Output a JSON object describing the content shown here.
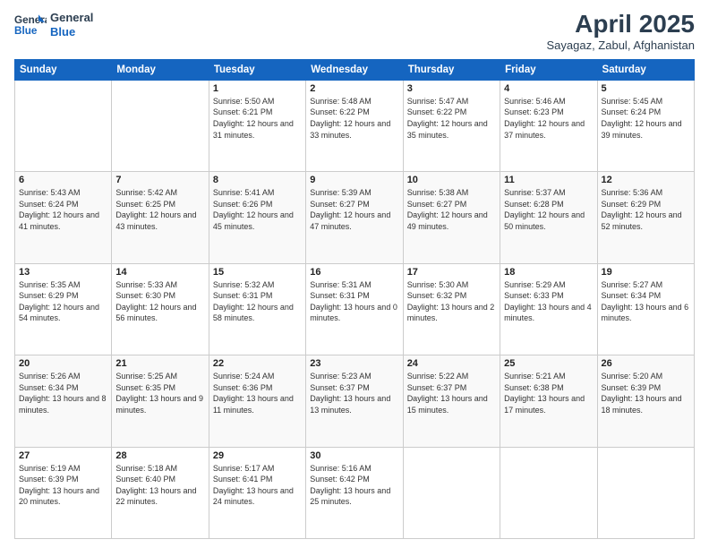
{
  "logo": {
    "line1": "General",
    "line2": "Blue"
  },
  "title": "April 2025",
  "subtitle": "Sayagaz, Zabul, Afghanistan",
  "weekdays": [
    "Sunday",
    "Monday",
    "Tuesday",
    "Wednesday",
    "Thursday",
    "Friday",
    "Saturday"
  ],
  "weeks": [
    [
      {
        "day": "",
        "info": ""
      },
      {
        "day": "",
        "info": ""
      },
      {
        "day": "1",
        "info": "Sunrise: 5:50 AM\nSunset: 6:21 PM\nDaylight: 12 hours\nand 31 minutes."
      },
      {
        "day": "2",
        "info": "Sunrise: 5:48 AM\nSunset: 6:22 PM\nDaylight: 12 hours\nand 33 minutes."
      },
      {
        "day": "3",
        "info": "Sunrise: 5:47 AM\nSunset: 6:22 PM\nDaylight: 12 hours\nand 35 minutes."
      },
      {
        "day": "4",
        "info": "Sunrise: 5:46 AM\nSunset: 6:23 PM\nDaylight: 12 hours\nand 37 minutes."
      },
      {
        "day": "5",
        "info": "Sunrise: 5:45 AM\nSunset: 6:24 PM\nDaylight: 12 hours\nand 39 minutes."
      }
    ],
    [
      {
        "day": "6",
        "info": "Sunrise: 5:43 AM\nSunset: 6:24 PM\nDaylight: 12 hours\nand 41 minutes."
      },
      {
        "day": "7",
        "info": "Sunrise: 5:42 AM\nSunset: 6:25 PM\nDaylight: 12 hours\nand 43 minutes."
      },
      {
        "day": "8",
        "info": "Sunrise: 5:41 AM\nSunset: 6:26 PM\nDaylight: 12 hours\nand 45 minutes."
      },
      {
        "day": "9",
        "info": "Sunrise: 5:39 AM\nSunset: 6:27 PM\nDaylight: 12 hours\nand 47 minutes."
      },
      {
        "day": "10",
        "info": "Sunrise: 5:38 AM\nSunset: 6:27 PM\nDaylight: 12 hours\nand 49 minutes."
      },
      {
        "day": "11",
        "info": "Sunrise: 5:37 AM\nSunset: 6:28 PM\nDaylight: 12 hours\nand 50 minutes."
      },
      {
        "day": "12",
        "info": "Sunrise: 5:36 AM\nSunset: 6:29 PM\nDaylight: 12 hours\nand 52 minutes."
      }
    ],
    [
      {
        "day": "13",
        "info": "Sunrise: 5:35 AM\nSunset: 6:29 PM\nDaylight: 12 hours\nand 54 minutes."
      },
      {
        "day": "14",
        "info": "Sunrise: 5:33 AM\nSunset: 6:30 PM\nDaylight: 12 hours\nand 56 minutes."
      },
      {
        "day": "15",
        "info": "Sunrise: 5:32 AM\nSunset: 6:31 PM\nDaylight: 12 hours\nand 58 minutes."
      },
      {
        "day": "16",
        "info": "Sunrise: 5:31 AM\nSunset: 6:31 PM\nDaylight: 13 hours\nand 0 minutes."
      },
      {
        "day": "17",
        "info": "Sunrise: 5:30 AM\nSunset: 6:32 PM\nDaylight: 13 hours\nand 2 minutes."
      },
      {
        "day": "18",
        "info": "Sunrise: 5:29 AM\nSunset: 6:33 PM\nDaylight: 13 hours\nand 4 minutes."
      },
      {
        "day": "19",
        "info": "Sunrise: 5:27 AM\nSunset: 6:34 PM\nDaylight: 13 hours\nand 6 minutes."
      }
    ],
    [
      {
        "day": "20",
        "info": "Sunrise: 5:26 AM\nSunset: 6:34 PM\nDaylight: 13 hours\nand 8 minutes."
      },
      {
        "day": "21",
        "info": "Sunrise: 5:25 AM\nSunset: 6:35 PM\nDaylight: 13 hours\nand 9 minutes."
      },
      {
        "day": "22",
        "info": "Sunrise: 5:24 AM\nSunset: 6:36 PM\nDaylight: 13 hours\nand 11 minutes."
      },
      {
        "day": "23",
        "info": "Sunrise: 5:23 AM\nSunset: 6:37 PM\nDaylight: 13 hours\nand 13 minutes."
      },
      {
        "day": "24",
        "info": "Sunrise: 5:22 AM\nSunset: 6:37 PM\nDaylight: 13 hours\nand 15 minutes."
      },
      {
        "day": "25",
        "info": "Sunrise: 5:21 AM\nSunset: 6:38 PM\nDaylight: 13 hours\nand 17 minutes."
      },
      {
        "day": "26",
        "info": "Sunrise: 5:20 AM\nSunset: 6:39 PM\nDaylight: 13 hours\nand 18 minutes."
      }
    ],
    [
      {
        "day": "27",
        "info": "Sunrise: 5:19 AM\nSunset: 6:39 PM\nDaylight: 13 hours\nand 20 minutes."
      },
      {
        "day": "28",
        "info": "Sunrise: 5:18 AM\nSunset: 6:40 PM\nDaylight: 13 hours\nand 22 minutes."
      },
      {
        "day": "29",
        "info": "Sunrise: 5:17 AM\nSunset: 6:41 PM\nDaylight: 13 hours\nand 24 minutes."
      },
      {
        "day": "30",
        "info": "Sunrise: 5:16 AM\nSunset: 6:42 PM\nDaylight: 13 hours\nand 25 minutes."
      },
      {
        "day": "",
        "info": ""
      },
      {
        "day": "",
        "info": ""
      },
      {
        "day": "",
        "info": ""
      }
    ]
  ]
}
